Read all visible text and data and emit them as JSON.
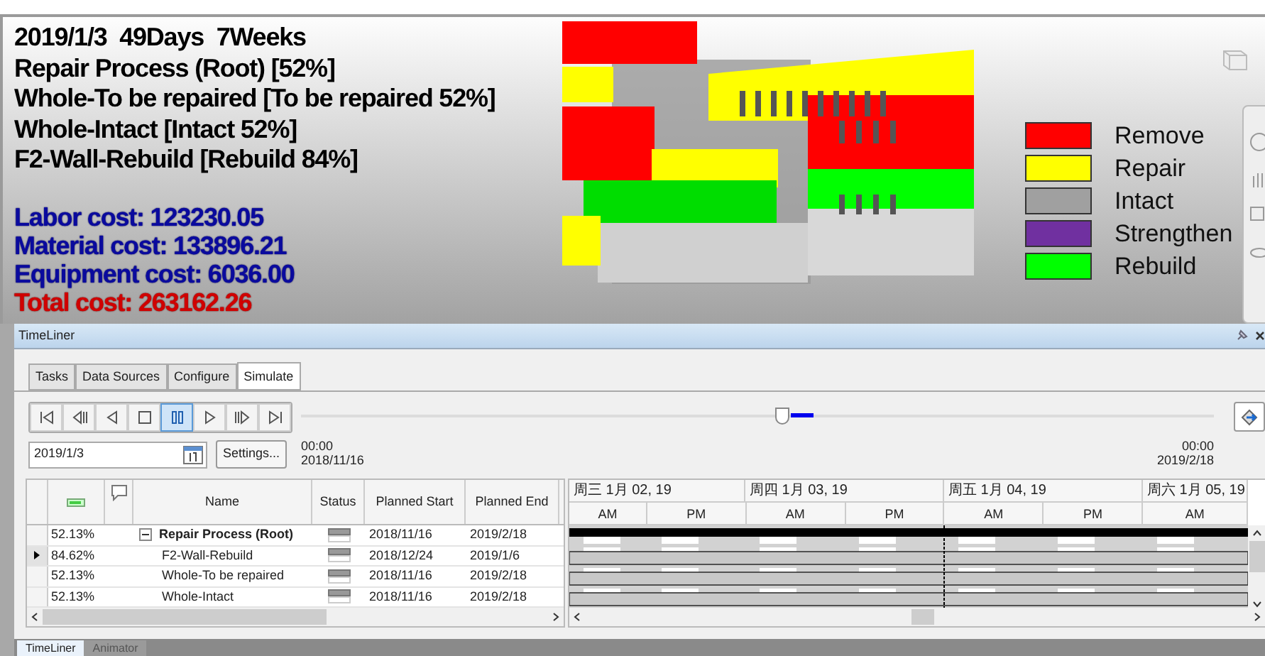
{
  "overlay": {
    "lines": [
      "2019/1/3  49Days  7Weeks",
      "Repair Process (Root) [52%]",
      "Whole-To be repaired [To be repaired 52%]",
      "Whole-Intact [Intact 52%]",
      "F2-Wall-Rebuild [Rebuild 84%]"
    ],
    "costs": [
      {
        "text": "Labor cost: 123230.05",
        "kind": "cost"
      },
      {
        "text": "Material cost: 133896.21",
        "kind": "cost"
      },
      {
        "text": "Equipment cost: 6036.00",
        "kind": "cost"
      },
      {
        "text": "Total cost: 263162.26",
        "kind": "total"
      }
    ]
  },
  "legend": [
    {
      "label": "Remove",
      "color": "#ff0000"
    },
    {
      "label": "Repair",
      "color": "#ffff00"
    },
    {
      "label": "Intact",
      "color": "#a0a0a0"
    },
    {
      "label": "Strengthen",
      "color": "#7030a0"
    },
    {
      "label": "Rebuild",
      "color": "#00ff00"
    }
  ],
  "timeliner": {
    "title": "TimeLiner",
    "tabs": [
      {
        "label": "Tasks",
        "selected": false
      },
      {
        "label": "Data Sources",
        "selected": false
      },
      {
        "label": "Configure",
        "selected": false
      },
      {
        "label": "Simulate",
        "selected": true
      }
    ],
    "transport": [
      {
        "kind": "first",
        "selected": false
      },
      {
        "kind": "step-back",
        "selected": false
      },
      {
        "kind": "reverse",
        "selected": false
      },
      {
        "kind": "stop",
        "selected": false
      },
      {
        "kind": "pause",
        "selected": true
      },
      {
        "kind": "play",
        "selected": false
      },
      {
        "kind": "step-forward",
        "selected": false
      },
      {
        "kind": "last",
        "selected": false
      }
    ],
    "slider": {
      "level": 0.52
    },
    "date_field": {
      "value": "2019/1/3"
    },
    "settings_button": "Settings...",
    "start": {
      "time": "00:00",
      "date": "2018/11/16"
    },
    "end": {
      "time": "00:00",
      "date": "2019/2/18"
    },
    "table": {
      "columns": [
        "Name",
        "Status",
        "Planned Start",
        "Planned End"
      ],
      "rows": [
        {
          "percent": "52.13%",
          "name": "Repair Process (Root)",
          "kind": "group",
          "expanded": true,
          "start": "2018/11/16",
          "end": "2019/2/18",
          "selected": false
        },
        {
          "percent": "84.62%",
          "name": "F2-Wall-Rebuild",
          "kind": "task",
          "start": "2018/12/24",
          "end": "2019/1/6",
          "selected": true
        },
        {
          "percent": "52.13%",
          "name": "Whole-To be repaired",
          "kind": "task",
          "start": "2018/11/16",
          "end": "2019/2/18",
          "selected": false
        },
        {
          "percent": "52.13%",
          "name": "Whole-Intact",
          "kind": "task",
          "start": "2018/11/16",
          "end": "2019/2/18",
          "selected": false
        }
      ]
    },
    "gantt": {
      "days": [
        "周三 1月 02, 19",
        "周四 1月 03, 19",
        "周五 1月 04, 19",
        "周六 1月 05, 19"
      ],
      "halves": [
        "AM",
        "PM",
        "AM",
        "PM",
        "AM",
        "PM",
        "AM"
      ]
    }
  },
  "bottom_tabs": [
    {
      "label": "TimeLiner",
      "selected": true
    },
    {
      "label": "Animator",
      "selected": false
    }
  ]
}
